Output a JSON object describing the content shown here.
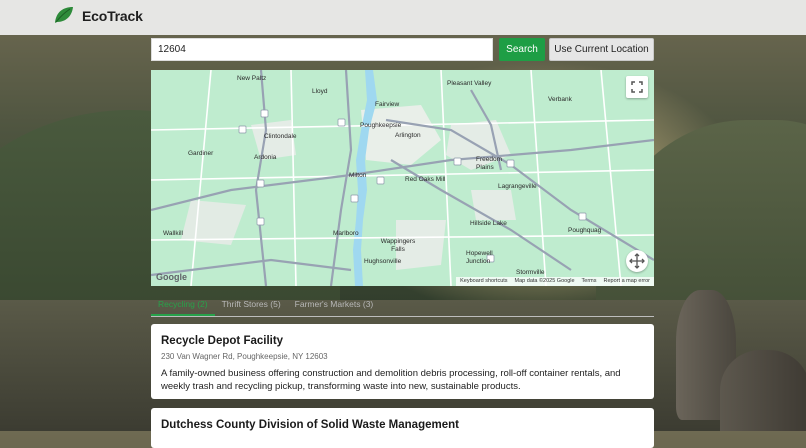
{
  "app": {
    "brand": "EcoTrack",
    "logo_icon": "leaf-icon"
  },
  "search": {
    "value": "12604",
    "button_label": "Search",
    "location_button_label": "Use Current Location"
  },
  "map": {
    "labels": [
      "Pleasant Valley",
      "New Paltz",
      "Lloyd",
      "Verbank",
      "Fairview",
      "Poughkeepsie",
      "Arlington",
      "Clintondale",
      "Gardiner",
      "Ardonia",
      "Milton",
      "Red Oaks Mill",
      "Freedom Plains",
      "Lagrangeville",
      "Hillside Lake",
      "Poughquag",
      "Wallkill",
      "Marlboro",
      "Wappingers Falls",
      "Hopewell Junction",
      "Hughsonville",
      "Stormville"
    ],
    "google_logo": "Google",
    "attribution": [
      "Keyboard shortcuts",
      "Map data ©2025 Google",
      "Terms",
      "Report a map error"
    ],
    "fullscreen_icon": "fullscreen-icon",
    "pan_icon": "pan-control-icon"
  },
  "tabs": [
    {
      "label": "Recycling (2)",
      "active": true
    },
    {
      "label": "Thrift Stores (5)",
      "active": false
    },
    {
      "label": "Farmer's Markets (3)",
      "active": false
    }
  ],
  "results": [
    {
      "title": "Recycle Depot Facility",
      "address": "230 Van Wagner Rd, Poughkeepsie, NY 12603",
      "description": "A family-owned business offering construction and demolition debris processing, roll-off container rentals, and weekly trash and recycling pickup, transforming waste into new, sustainable products."
    },
    {
      "title": "Dutchess County Division of Solid Waste Management"
    }
  ],
  "colors": {
    "accent": "#1e9e45",
    "header_bg": "#e6e6e4",
    "map_land": "#bfeccf",
    "map_water": "#9fd8f0"
  }
}
